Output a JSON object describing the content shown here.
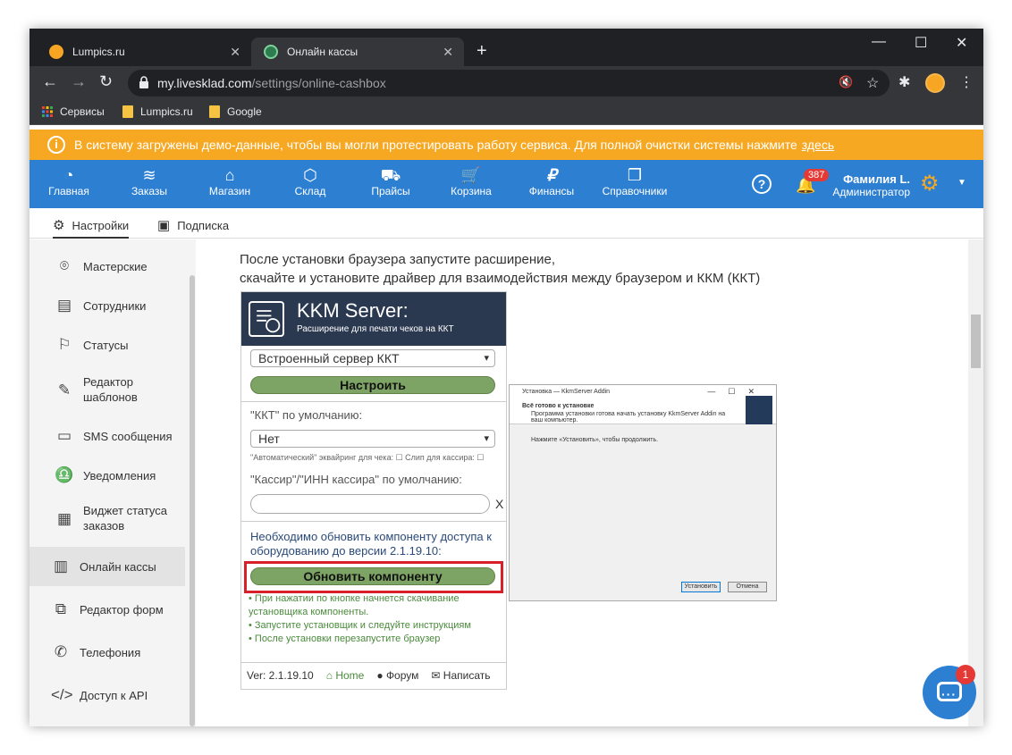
{
  "browser": {
    "tabs": [
      {
        "title": "Lumpics.ru",
        "favicon_color": "#f6a623"
      },
      {
        "title": "Онлайн кассы",
        "favicon_color": "#4caf50"
      }
    ],
    "url_host": "my.livesklad.com",
    "url_path": "/settings/online-cashbox",
    "bookmarks": [
      "Сервисы",
      "Lumpics.ru",
      "Google"
    ]
  },
  "banner": {
    "text": "В систему загружены демо-данные, чтобы вы могли протестировать работу сервиса. Для полной очистки системы нажмите",
    "link": "здесь"
  },
  "nav": {
    "items": [
      "Главная",
      "Заказы",
      "Магазин",
      "Склад",
      "Прайсы",
      "Корзина",
      "Финансы",
      "Справочники"
    ],
    "notifications_count": "387",
    "user_name": "Фамилия L.",
    "user_role": "Администратор"
  },
  "subtabs": [
    "Настройки",
    "Подписка"
  ],
  "sidebar": [
    "Мастерские",
    "Сотрудники",
    "Статусы",
    "Редактор шаблонов",
    "SMS сообщения",
    "Уведомления",
    "Виджет статуса заказов",
    "Онлайн кассы",
    "Редактор форм",
    "Телефония",
    "Доступ к API"
  ],
  "content": {
    "intro_line1": "После установки браузера запустите расширение,",
    "intro_line2": "скачайте и установите драйвер для взаимодействия между браузером и ККМ (ККТ)"
  },
  "kkm": {
    "title": "KKM Server:",
    "subtitle": "Расширение для печати чеков на ККТ",
    "server_select": "Встроенный сервер ККТ",
    "configure_btn": "Настроить",
    "default_kkt_label": "\"ККТ\" по умолчанию:",
    "default_kkt_value": "Нет",
    "options_text": "\"Автоматический\" эквайринг для чека: ☐ Слип для кассира: ☐",
    "cashier_label": "\"Кассир\"/\"ИНН кассира\" по умолчанию:",
    "clear_x": "X",
    "update_msg": "Необходимо обновить компоненту доступа к оборудованию до версии 2.1.19.10:",
    "update_btn": "Обновить компоненту",
    "bullets": [
      "• При нажатии по кнопке начнется скачивание установщика компоненты.",
      "• Запустите установщик и следуйте инструкциям",
      "• После установки перезапустите браузер"
    ],
    "version": "Ver: 2.1.19.10",
    "home": "Home",
    "forum": "Форум",
    "write": "Написать"
  },
  "installer": {
    "title": "Установка — KkmServer Addin",
    "heading": "Всё готово к установке",
    "desc": "Программа установки готова начать установку KkmServer Addin на ваш компьютер.",
    "body": "Нажмите «Установить», чтобы продолжить.",
    "install_btn": "Установить",
    "cancel_btn": "Отмена"
  },
  "chat": {
    "badge": "1"
  }
}
